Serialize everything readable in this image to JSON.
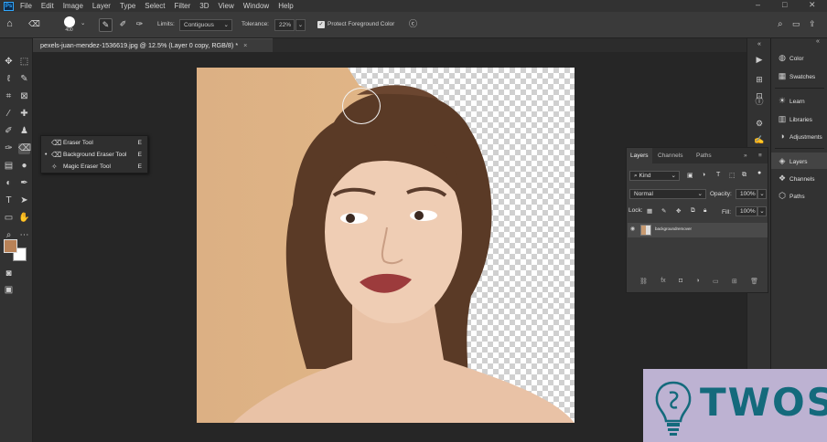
{
  "menubar": {
    "items": [
      "File",
      "Edit",
      "Image",
      "Layer",
      "Type",
      "Select",
      "Filter",
      "3D",
      "View",
      "Window",
      "Help"
    ],
    "window_controls": [
      "–",
      "□",
      "✕"
    ]
  },
  "options": {
    "brush_size": "400",
    "limits_label": "Limits:",
    "limits_value": "Contiguous",
    "tolerance_label": "Tolerance:",
    "tolerance_value": "22%",
    "protect_label": "Protect Foreground Color"
  },
  "document": {
    "tab_title": "pexels-juan-mendez-1536619.jpg @ 12.5% (Layer 0 copy, RGB/8) *",
    "close": "×"
  },
  "flyout": {
    "items": [
      {
        "label": "Eraser Tool",
        "key": "E",
        "mark": ""
      },
      {
        "label": "Background Eraser Tool",
        "key": "E",
        "mark": "•"
      },
      {
        "label": "Magic Eraser Tool",
        "key": "E",
        "mark": ""
      }
    ]
  },
  "dock": {
    "items": [
      {
        "label": "Color",
        "icon": "color-wheel-icon"
      },
      {
        "label": "Swatches",
        "icon": "grid-icon"
      },
      {
        "label": "Learn",
        "icon": "bulb-icon"
      },
      {
        "label": "Libraries",
        "icon": "library-icon"
      },
      {
        "label": "Adjustments",
        "icon": "adjust-icon"
      },
      {
        "label": "Layers",
        "icon": "layers-icon"
      },
      {
        "label": "Channels",
        "icon": "channels-icon"
      },
      {
        "label": "Paths",
        "icon": "paths-icon"
      }
    ]
  },
  "layers_panel": {
    "tabs": [
      "Layers",
      "Channels",
      "Paths"
    ],
    "kind_label": "Kind",
    "blend_mode": "Normal",
    "opacity_label": "Opacity:",
    "opacity_value": "100%",
    "lock_label": "Lock:",
    "fill_label": "Fill:",
    "fill_value": "100%",
    "layer_name": "backgroundremover"
  },
  "colors": {
    "foreground": "#b98257",
    "background": "#ffffff",
    "accent": "#31a8ff"
  },
  "watermark": {
    "text": "TWOS"
  }
}
